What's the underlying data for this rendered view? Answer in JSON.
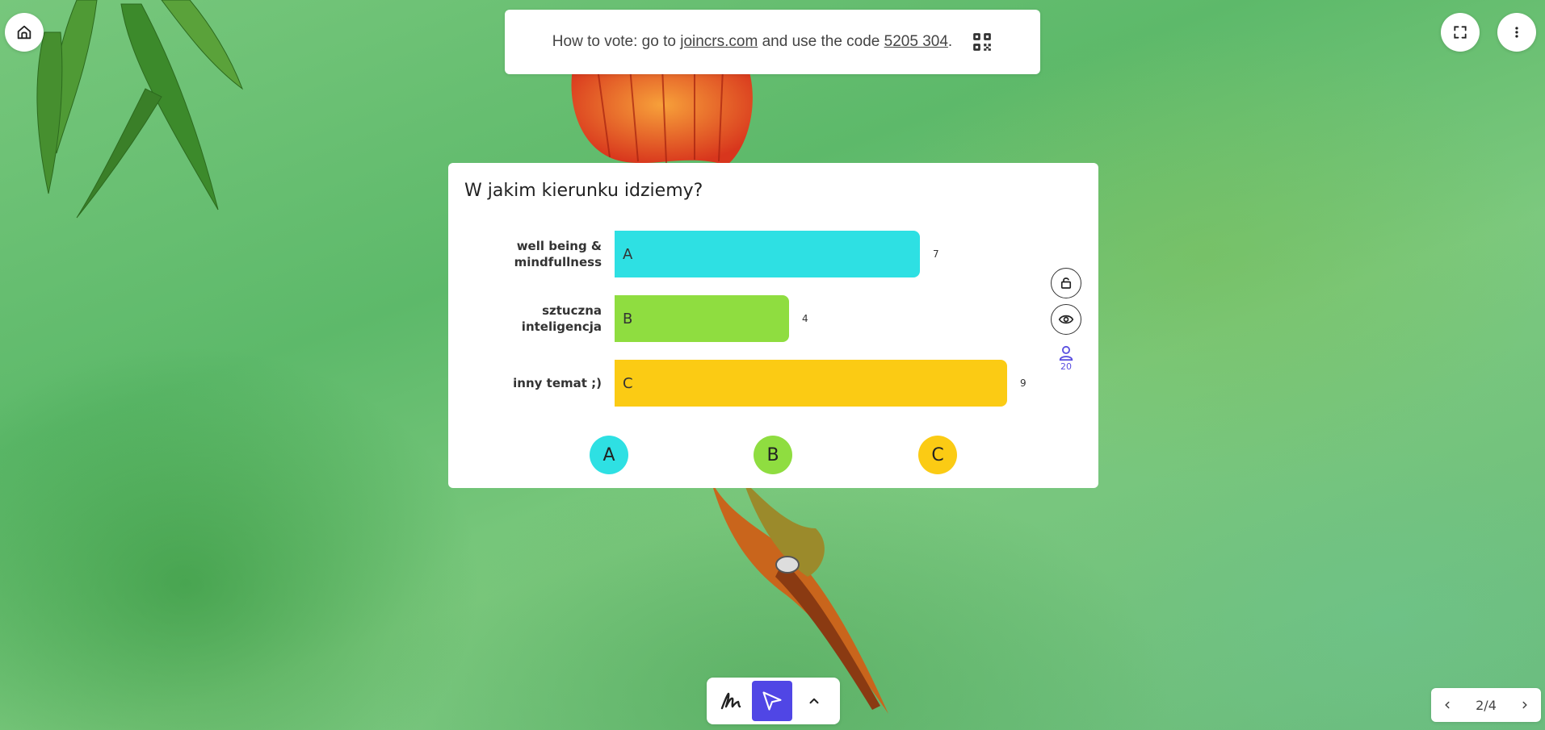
{
  "banner": {
    "prefix": "How to vote: go to",
    "link": "joincrs.com",
    "middle": "and use the code",
    "code": "5205 304",
    "suffix": "."
  },
  "poll": {
    "question": "W jakim kierunku idziemy?",
    "participants": "20",
    "options": [
      {
        "label_line1": "well being &",
        "label_line2": "mindfullness",
        "letter": "A",
        "count": "7",
        "color": "#2ee0e3"
      },
      {
        "label_line1": "sztuczna",
        "label_line2": "inteligencja",
        "letter": "B",
        "count": "4",
        "color": "#8fdd40"
      },
      {
        "label_line1": "inny temat ;)",
        "label_line2": "",
        "letter": "C",
        "count": "9",
        "color": "#fbcb14"
      }
    ],
    "option_buttons": [
      {
        "letter": "A",
        "color": "#2ee0e3"
      },
      {
        "letter": "B",
        "color": "#8fdd40"
      },
      {
        "letter": "C",
        "color": "#fbcb14"
      }
    ]
  },
  "chart_data": {
    "type": "bar",
    "orientation": "horizontal",
    "title": "W jakim kierunku idziemy?",
    "categories": [
      "well being & mindfullness",
      "sztuczna inteligencja",
      "inny temat ;)"
    ],
    "values": [
      7,
      4,
      9
    ]
  },
  "pager": {
    "label": "2/4"
  },
  "icons": {
    "home": "home-icon",
    "fullscreen": "fullscreen-icon",
    "more": "more-vertical-icon",
    "qr": "qr-code-icon",
    "lock": "lock-icon",
    "eye": "eye-icon",
    "user": "user-icon",
    "pen": "pen-icon",
    "pointer": "pointer-icon",
    "chevron_up": "chevron-up-icon",
    "chevron_left": "chevron-left-icon",
    "chevron_right": "chevron-right-icon"
  },
  "colors": {
    "accent": "#5046e5"
  }
}
